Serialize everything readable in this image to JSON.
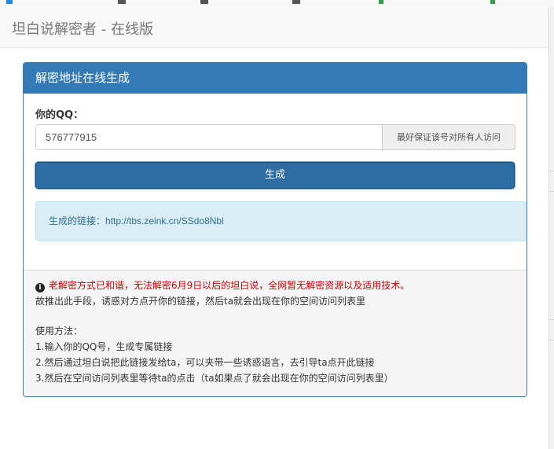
{
  "navbar": {
    "brand": "坦白说解密者 - 在线版"
  },
  "panel": {
    "title": "解密地址在线生成",
    "qq_label": "你的QQ：",
    "qq_value": "576777915",
    "qq_hint": "最好保证该号对所有人访问",
    "generate_label": "生成",
    "result_prefix": "生成的链接：",
    "result_link": "http://tbs.zeink.cn/SSdo8Nbl"
  },
  "footer": {
    "warning": "老解密方式已和谐，无法解密6月9日以后的坦白说，全网暂无解密资源以及适用技术。",
    "note": "故推出此手段，诱惑对方点开你的链接，然后ta就会出现在你的空间访问列表里",
    "usage_title": "使用方法：",
    "steps": [
      "1.输入你的QQ号，生成专属链接",
      "2.然后通过坦白说把此链接发给ta，可以夹带一些诱惑语言，去引导ta点开此链接",
      "3.然后在空间访问列表里等待ta的点击（ta如果点了就会出现在你的空间访问列表里）"
    ]
  },
  "colors": {
    "primary": "#337ab7",
    "button": "#2e6da4",
    "alert_bg": "#d9edf7",
    "warning": "#cc0000"
  }
}
